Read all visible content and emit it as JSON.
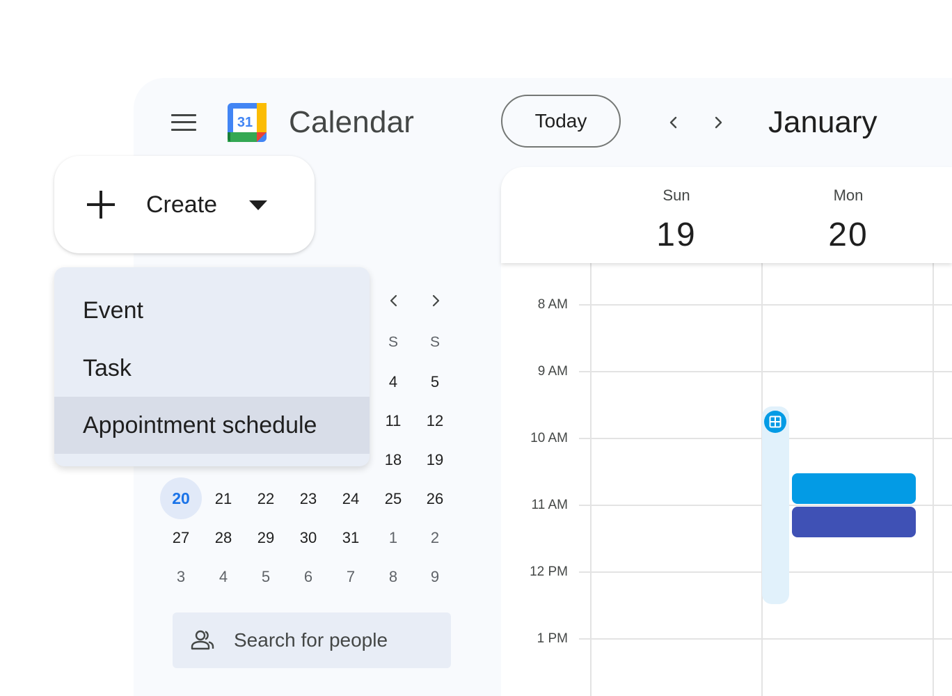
{
  "header": {
    "app_title": "Calendar",
    "logo_number": "31",
    "today_label": "Today",
    "month_title": "January"
  },
  "create": {
    "label": "Create",
    "menu_items": [
      "Event",
      "Task",
      "Appointment schedule"
    ],
    "selected_item": "Appointment schedule"
  },
  "mini_calendar": {
    "dow_visible": [
      "S",
      "S"
    ],
    "rows": [
      [
        "4",
        "5"
      ],
      [
        "11",
        "12"
      ],
      [
        "18",
        "19"
      ],
      [
        "20",
        "21",
        "22",
        "23",
        "24",
        "25",
        "26"
      ],
      [
        "27",
        "28",
        "29",
        "30",
        "31",
        "1",
        "2"
      ],
      [
        "3",
        "4",
        "5",
        "6",
        "7",
        "8",
        "9"
      ]
    ],
    "today": "20"
  },
  "search_people": {
    "placeholder": "Search for people"
  },
  "days": [
    {
      "name": "Sun",
      "number": "19"
    },
    {
      "name": "Mon",
      "number": "20"
    }
  ],
  "time_labels": [
    "8 AM",
    "9 AM",
    "10 AM",
    "11 AM",
    "12 PM",
    "1 PM"
  ],
  "colors": {
    "event_blue": "#039be5",
    "event_indigo": "#3f51b5",
    "today_highlight": "#1a73e8",
    "panel_background": "#f8fafd"
  },
  "icons": {
    "menu": "hamburger-icon",
    "create": "plus-icon",
    "caret": "caret-down-icon",
    "prev": "chevron-left-icon",
    "next": "chevron-right-icon",
    "appointment": "appointment-grid-icon",
    "people": "people-icon"
  }
}
